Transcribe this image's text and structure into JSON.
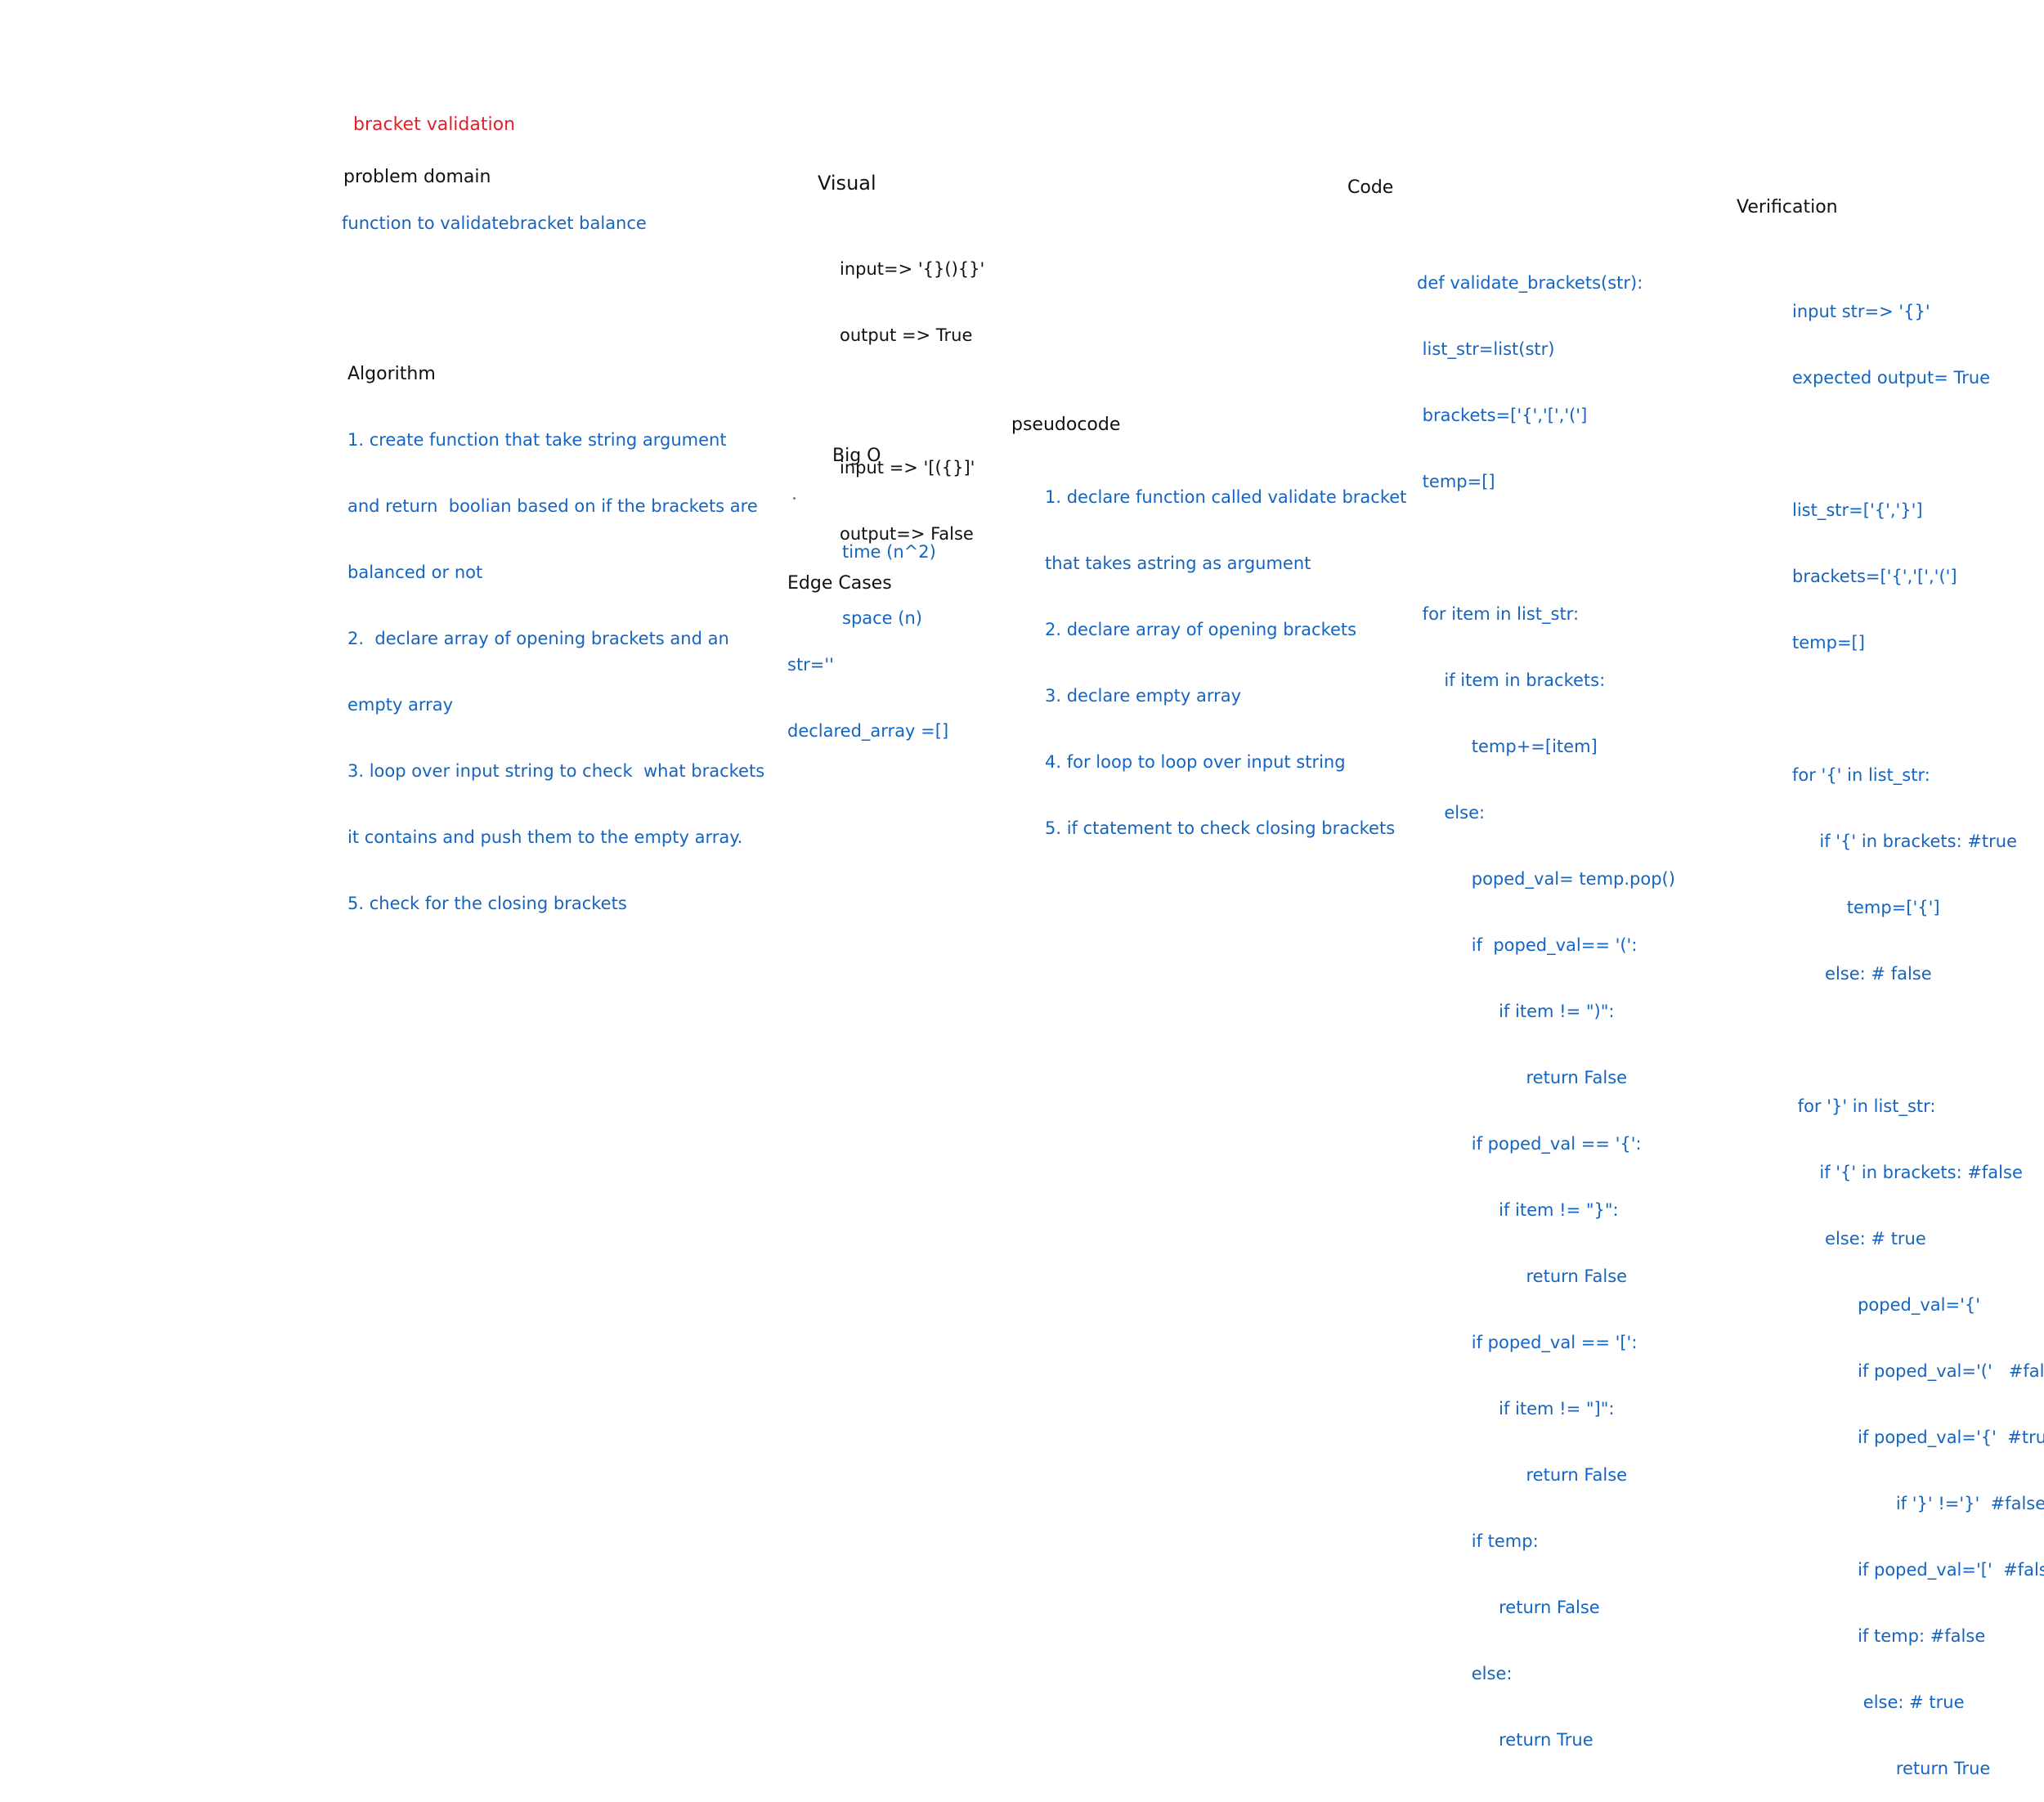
{
  "title": "bracket validation",
  "sections": {
    "problem_domain": {
      "heading": "problem domain",
      "text": "function to validatebracket balance"
    },
    "visual": {
      "heading": "Visual",
      "lines": [
        "input=> '{}(){}'",
        "output => True",
        "",
        "input => '[({}]'",
        "output=> False"
      ]
    },
    "code": {
      "heading": "Code",
      "lines": [
        "def validate_brackets(str):",
        " list_str=list(str)",
        " brackets=['{','[','(']",
        " temp=[]",
        "",
        " for item in list_str:",
        "     if item in brackets:",
        "          temp+=[item]",
        "     else:",
        "          poped_val= temp.pop()",
        "          if  poped_val== '(':",
        "               if item != \")\":",
        "                    return False",
        "          if poped_val == '{':",
        "               if item != \"}\":",
        "                    return False",
        "          if poped_val == '[':",
        "               if item != \"]\":",
        "                    return False",
        "          if temp:",
        "               return False",
        "          else:",
        "               return True"
      ]
    },
    "verification": {
      "heading": "Verification",
      "lines": [
        "input str=> '{}'",
        "expected output= True",
        "",
        "list_str=['{','}']",
        "brackets=['{','[','(']",
        "temp=[]",
        "",
        "for '{' in list_str:",
        "     if '{' in brackets: #true",
        "          temp=['{']",
        "      else: # false",
        "",
        " for '}' in list_str:",
        "     if '{' in brackets: #false",
        "      else: # true",
        "            poped_val='{'",
        "            if poped_val='('   #false",
        "            if poped_val='{'  #true",
        "                   if '}' !='}'  #false",
        "            if poped_val='['  #false",
        "            if temp: #false",
        "             else: # true",
        "                   return True"
      ]
    },
    "algorithm": {
      "heading": "Algorithm",
      "lines": [
        "1. create function that take string argument",
        "and return  boolian based on if the brackets are",
        "balanced or not",
        "2.  declare array of opening brackets and an",
        "empty array",
        "3. loop over input string to check  what brackets",
        "it contains and push them to the empty array.",
        "5. check for the closing brackets"
      ]
    },
    "big_o": {
      "heading": "Big O",
      "lines": [
        "time (n^2)",
        "space (n)"
      ]
    },
    "edge_cases": {
      "heading": "Edge Cases",
      "lines": [
        "str=''",
        "declared_array =[]"
      ]
    },
    "pseudocode": {
      "heading": "pseudocode",
      "lines": [
        "1. declare function called validate bracket",
        "that takes astring as argument",
        "2. declare array of opening brackets",
        "3. declare empty array",
        "4. for loop to loop over input string",
        "5. if ctatement to check closing brackets"
      ]
    }
  },
  "colors": {
    "heading": "#111111",
    "body": "#1565c0",
    "title": "#e0202a"
  }
}
